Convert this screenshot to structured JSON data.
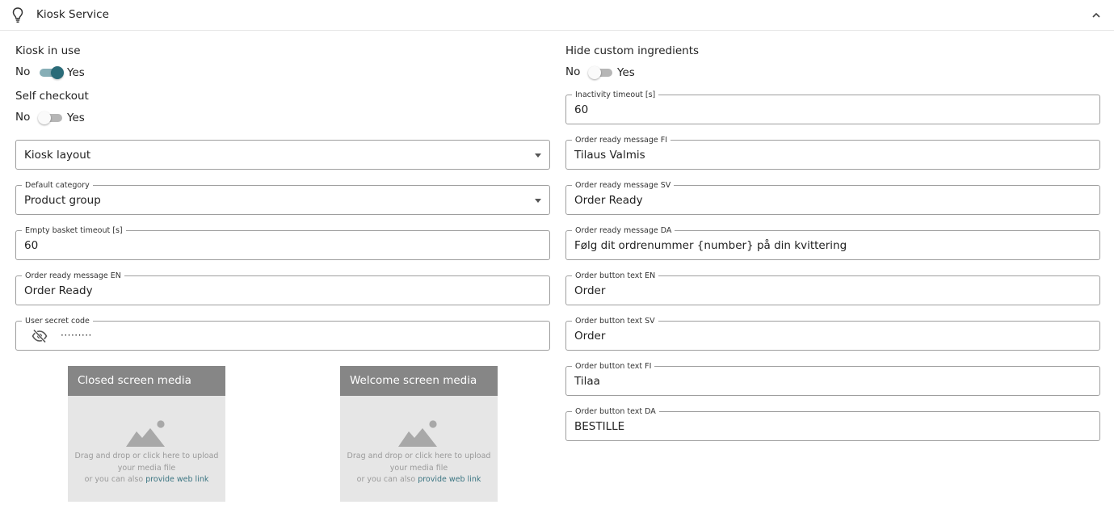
{
  "header": {
    "title": "Kiosk Service",
    "icon": "lightbulb-icon",
    "collapse_icon": "chevron-up-icon"
  },
  "left": {
    "kiosk_in_use": {
      "label": "Kiosk in use",
      "no": "No",
      "yes": "Yes",
      "value": true
    },
    "self_checkout": {
      "label": "Self checkout",
      "no": "No",
      "yes": "Yes",
      "value": false
    },
    "kiosk_layout": {
      "placeholder": "Kiosk layout",
      "value": ""
    },
    "default_category": {
      "label": "Default category",
      "value": "Product group"
    },
    "empty_basket_timeout": {
      "label": "Empty basket timeout [s]",
      "value": "60"
    },
    "order_ready_en": {
      "label": "Order ready message EN",
      "value": "Order Ready"
    },
    "user_secret_code": {
      "label": "User secret code",
      "value": "·········"
    }
  },
  "media": {
    "closed": {
      "title": "Closed screen media",
      "line1": "Drag and drop or click here to upload",
      "line2": "your media file",
      "line3": "or you can also ",
      "link": "provide web link"
    },
    "welcome": {
      "title": "Welcome screen media",
      "line1": "Drag and drop or click here to upload",
      "line2": "your media file",
      "line3": "or you can also ",
      "link": "provide web link"
    }
  },
  "right": {
    "hide_custom_ingredients": {
      "label": "Hide custom ingredients",
      "no": "No",
      "yes": "Yes",
      "value": false
    },
    "inactivity_timeout": {
      "label": "Inactivity timeout [s]",
      "value": "60"
    },
    "order_ready_fi": {
      "label": "Order ready message FI",
      "value": "Tilaus Valmis"
    },
    "order_ready_sv": {
      "label": "Order ready message SV",
      "value": "Order Ready"
    },
    "order_ready_da": {
      "label": "Order ready message DA",
      "value": "Følg dit ordrenummer {number} på din kvittering"
    },
    "order_button_en": {
      "label": "Order button text EN",
      "value": "Order"
    },
    "order_button_sv": {
      "label": "Order button text SV",
      "value": "Order"
    },
    "order_button_fi": {
      "label": "Order button text FI",
      "value": "Tilaa"
    },
    "order_button_da": {
      "label": "Order button text DA",
      "value": "BESTILLE"
    }
  },
  "colors": {
    "accent": "#2a6b78",
    "accent_track": "#86aeb6",
    "link": "#3b7582",
    "media_header": "#868686",
    "media_bg": "#e6e6e6"
  }
}
